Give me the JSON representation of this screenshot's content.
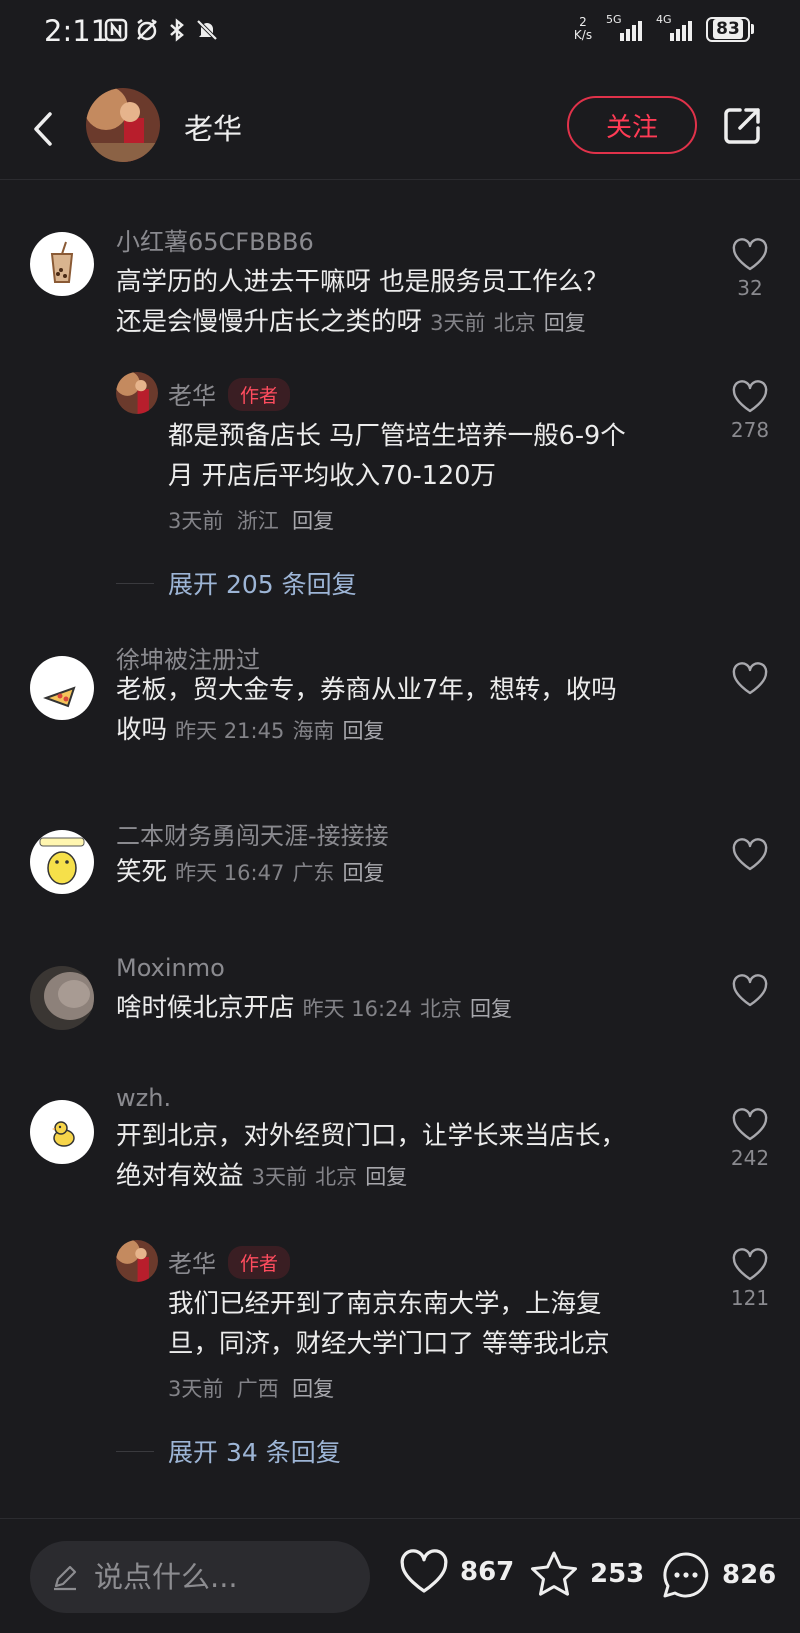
{
  "status_bar": {
    "time": "2:11",
    "net_speed_top": "2",
    "net_speed_bottom": "K/s",
    "sig1_label": "5G",
    "sig2_label": "4G",
    "battery": "83"
  },
  "header": {
    "author_name": "老华",
    "follow_label": "关注"
  },
  "comments": [
    {
      "user": "小红薯65CFBBB6",
      "line1": "高学历的人进去干嘛呀 也是服务员工作么？",
      "line2": "还是会慢慢升店长之类的呀",
      "time": "3天前",
      "location": "北京",
      "reply": "回复",
      "likes": "32",
      "sub": {
        "user": "老华",
        "tag": "作者",
        "line1": "都是预备店长 马厂管培生培养一般6-9个",
        "line2": "月 开店后平均收入70-120万",
        "time": "3天前",
        "location": "浙江",
        "reply": "回复",
        "likes": "278"
      },
      "expand": "展开 205 条回复"
    },
    {
      "user": "徐坤被注册过",
      "line1": "老板，贸大金专，券商从业7年，想转，收吗",
      "line2": "收吗",
      "time": "昨天 21:45",
      "location": "海南",
      "reply": "回复",
      "likes": ""
    },
    {
      "user": "二本财务勇闯天涯-接接接",
      "line1": "笑死",
      "time": "昨天 16:47",
      "location": "广东",
      "reply": "回复",
      "likes": ""
    },
    {
      "user": "Moxinmo",
      "line1": "啥时候北京开店",
      "time": "昨天 16:24",
      "location": "北京",
      "reply": "回复",
      "likes": ""
    },
    {
      "user": "wzh.",
      "line1": "开到北京，对外经贸门口，让学长来当店长，",
      "line2": "绝对有效益",
      "time": "3天前",
      "location": "北京",
      "reply": "回复",
      "likes": "242",
      "sub": {
        "user": "老华",
        "tag": "作者",
        "line1": "我们已经开到了南京东南大学，上海复",
        "line2": "旦，同济，财经大学门口了 等等我北京",
        "time": "3天前",
        "location": "广西",
        "reply": "回复",
        "likes": "121"
      },
      "expand": "展开 34 条回复"
    }
  ],
  "bottom_bar": {
    "input_placeholder": "说点什么...",
    "likes": "867",
    "favorites": "253",
    "comments": "826"
  },
  "colors": {
    "background": "#1b1b1e",
    "accent_red": "#ff3b55",
    "expand_link": "#9db5d6"
  }
}
